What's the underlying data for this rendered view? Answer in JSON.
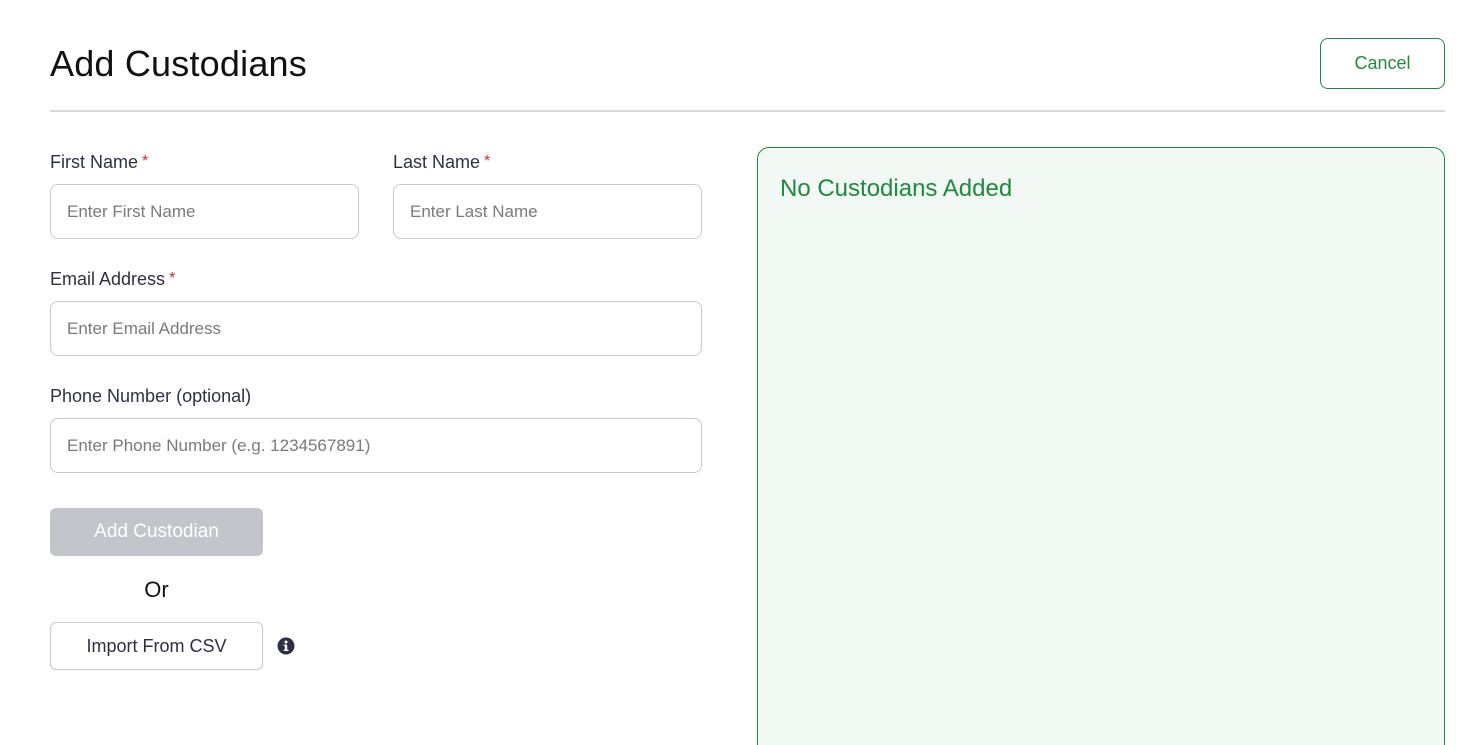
{
  "header": {
    "title": "Add Custodians",
    "cancel_label": "Cancel"
  },
  "form": {
    "first_name": {
      "label": "First Name",
      "required_mark": "*",
      "placeholder": "Enter First Name",
      "value": ""
    },
    "last_name": {
      "label": "Last Name",
      "required_mark": "*",
      "placeholder": "Enter Last Name",
      "value": ""
    },
    "email": {
      "label": "Email Address",
      "required_mark": "*",
      "placeholder": "Enter Email Address",
      "value": ""
    },
    "phone": {
      "label": "Phone Number (optional)",
      "placeholder": "Enter Phone Number (e.g. 1234567891)",
      "value": ""
    },
    "add_button_label": "Add Custodian",
    "add_button_disabled": true,
    "or_text": "Or",
    "import_button_label": "Import From CSV",
    "info_icon": "info-circle-icon"
  },
  "panel": {
    "empty_message": "No Custodians Added"
  },
  "colors": {
    "accent": "#1f8a3f",
    "panel_background": "#f2f8f3",
    "required": "#d6283c",
    "disabled_button": "#c3c5ca",
    "divider": "#d9d9d9"
  }
}
